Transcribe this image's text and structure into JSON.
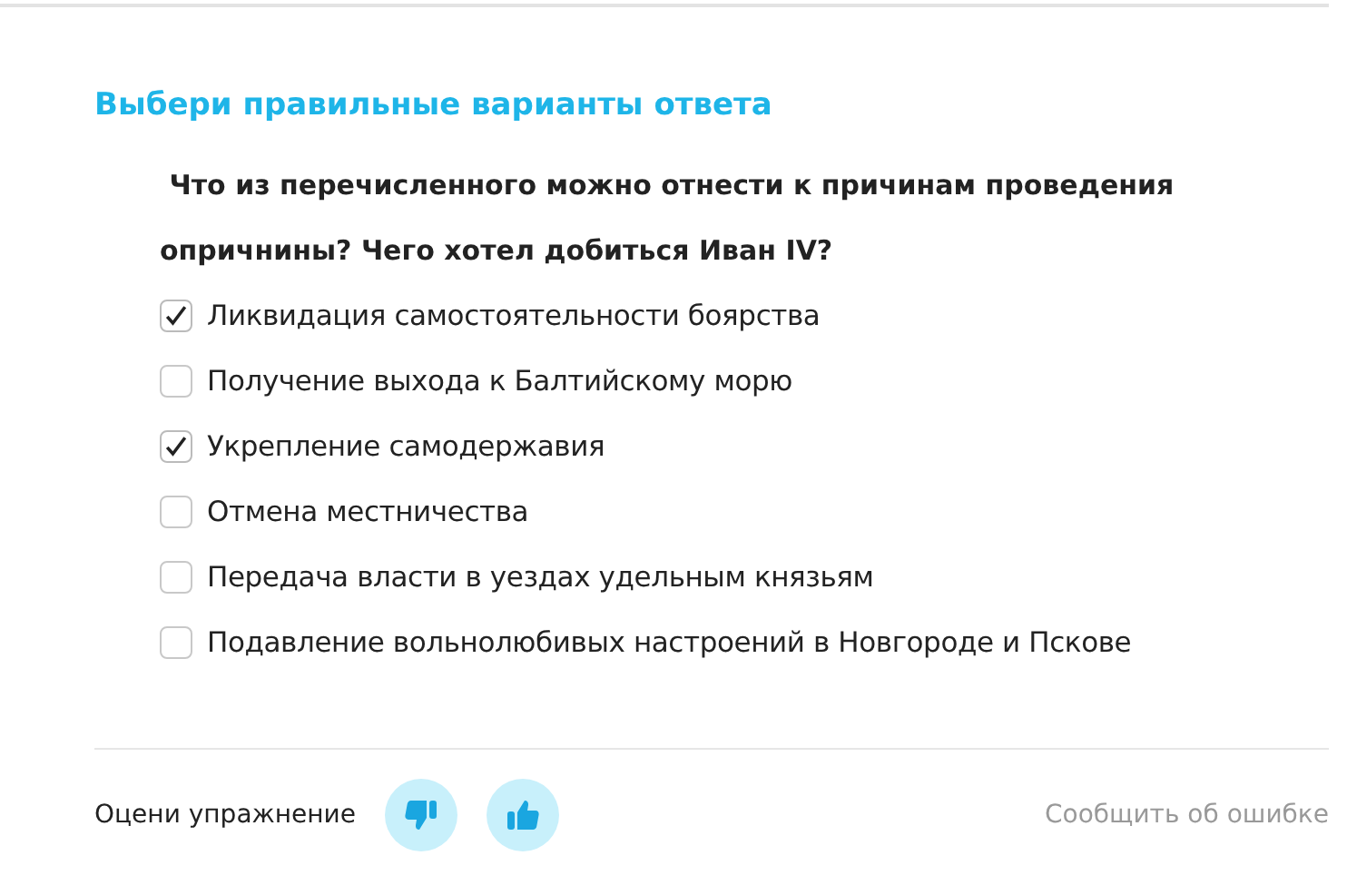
{
  "task": {
    "heading": "Выбери правильные варианты ответа",
    "question": " Что из перечисленного можно отнести к причинам проведения опричнины? Чего хотел добиться Иван IV?",
    "options": [
      {
        "label": "Ликвидация самостоятельности боярства",
        "checked": true
      },
      {
        "label": "Получение выхода к Балтийскому морю",
        "checked": false
      },
      {
        "label": "Укрепление самодержавия",
        "checked": true
      },
      {
        "label": "Отмена местничества",
        "checked": false
      },
      {
        "label": "Передача власти в уездах удельным князьям",
        "checked": false
      },
      {
        "label": "Подавление вольнолюбивых настроений в Новгороде и Пскове",
        "checked": false
      }
    ]
  },
  "footer": {
    "rate_label": "Оцени упражнение",
    "report_link": "Сообщить об ошибке"
  }
}
